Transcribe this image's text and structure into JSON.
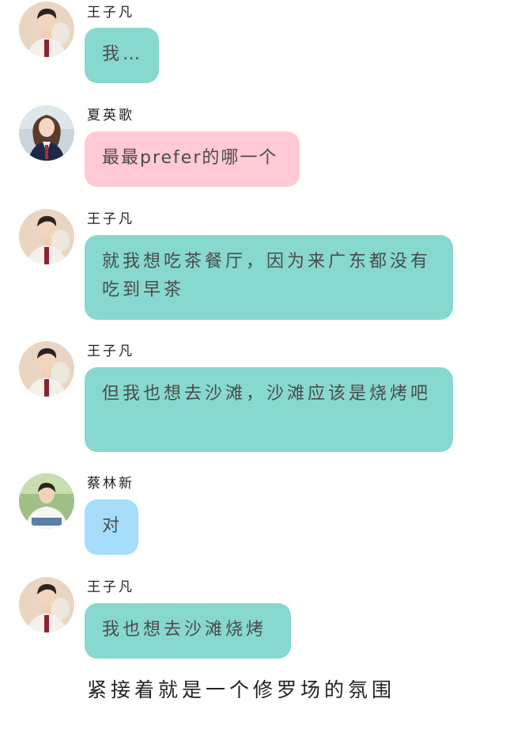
{
  "colors": {
    "teal_bubble": "#87d9cf",
    "pink_bubble": "#ffc9d5",
    "blue_bubble": "#a6ddfa"
  },
  "messages": [
    {
      "sender": "王子凡",
      "text": "我…",
      "avatar": "boy-uniform-avatar",
      "bubble_color": "teal"
    },
    {
      "sender": "夏英歌",
      "text": "最最prefer的哪一个",
      "avatar": "girl-uniform-avatar",
      "bubble_color": "pink"
    },
    {
      "sender": "王子凡",
      "text": "就我想吃茶餐厅，因为来广东都没有吃到早茶",
      "avatar": "boy-uniform-avatar",
      "bubble_color": "teal"
    },
    {
      "sender": "王子凡",
      "text": "但我也想去沙滩，沙滩应该是烧烤吧",
      "avatar": "boy-uniform-avatar",
      "bubble_color": "teal"
    },
    {
      "sender": "蔡林新",
      "text": "对",
      "avatar": "boy-outdoor-avatar",
      "bubble_color": "blue"
    },
    {
      "sender": "王子凡",
      "text": "我也想去沙滩烧烤",
      "avatar": "boy-uniform-avatar",
      "bubble_color": "teal"
    }
  ],
  "caption": "紧接着就是一个修罗场的氛围"
}
